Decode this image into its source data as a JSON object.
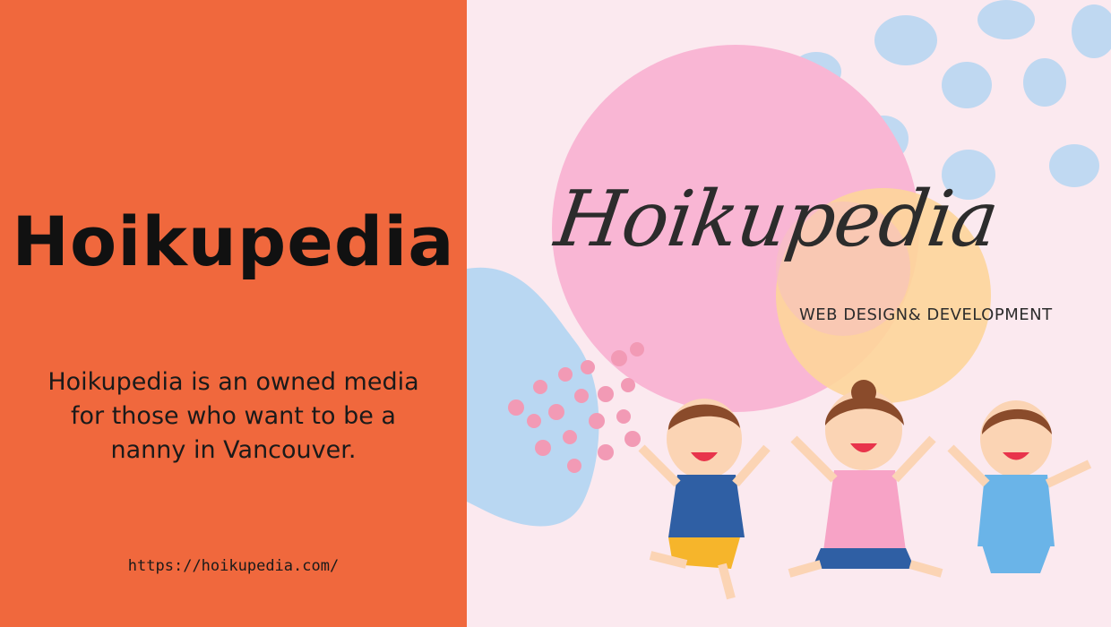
{
  "left": {
    "title": "Hoikupedia",
    "description": "Hoikupedia is an owned media for those who want to be a nanny in Vancouver.",
    "url": "https://hoikupedia.com/"
  },
  "logo": {
    "title": "Hoikupedia",
    "subtitle": "WEB DESIGN& DEVELOPMENT"
  },
  "colors": {
    "orange": "#f0683d",
    "pink_bg": "#fbe9ef",
    "pink_circle": "#f9b6d4",
    "peach_circle": "#fdd59a",
    "blue_blob": "#b9d7f2"
  }
}
